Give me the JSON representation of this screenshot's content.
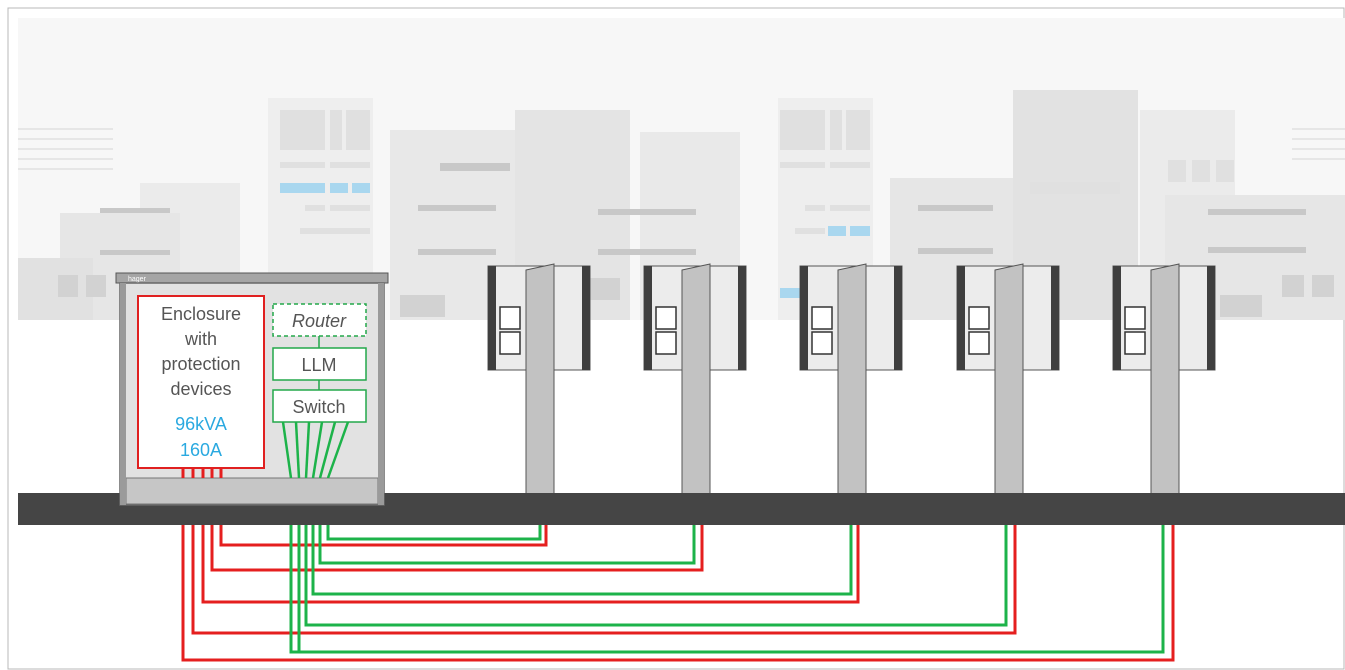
{
  "enclosure": {
    "brand": "hager",
    "label_lines": [
      "Enclosure",
      "with",
      "protection",
      "devices"
    ],
    "rating_lines": [
      "96kVA",
      "160A"
    ]
  },
  "network": {
    "router_label": "Router",
    "llm_label": "LLM",
    "switch_label": "Switch"
  },
  "charging_stations": [
    {
      "id": "station-1"
    },
    {
      "id": "station-2"
    },
    {
      "id": "station-3"
    },
    {
      "id": "station-4"
    },
    {
      "id": "station-5"
    }
  ],
  "colors": {
    "power_cable": "#e51f1f",
    "data_cable": "#1db34a",
    "rating_text": "#2aa9e0",
    "ground": "#454545",
    "enclosure_border": "#e02020",
    "network_border": "#23a84a"
  }
}
